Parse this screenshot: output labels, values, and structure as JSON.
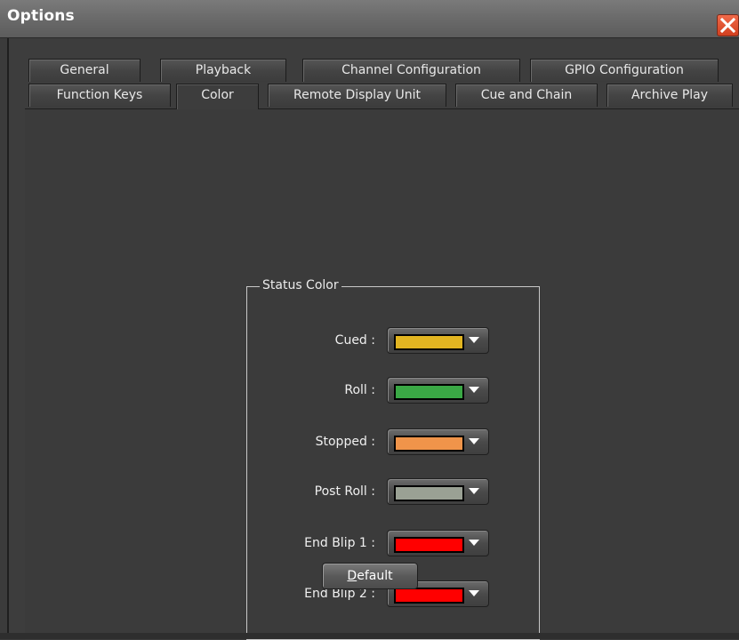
{
  "window": {
    "title": "Options"
  },
  "tabs": {
    "row1": [
      {
        "label": "General"
      },
      {
        "label": "Playback"
      },
      {
        "label": "Channel Configuration"
      },
      {
        "label": "GPIO Configuration"
      }
    ],
    "row2": [
      {
        "label": "Function Keys"
      },
      {
        "label": "Color",
        "active": true
      },
      {
        "label": "Remote Display Unit"
      },
      {
        "label": "Cue and Chain"
      },
      {
        "label": "Archive Play"
      }
    ]
  },
  "status_color": {
    "title": "Status Color",
    "rows": [
      {
        "label": "Cued :",
        "color": "#e2b521"
      },
      {
        "label": "Roll :",
        "color": "#3aa845"
      },
      {
        "label": "Stopped :",
        "color": "#f0944a"
      },
      {
        "label": "Post Roll :",
        "color": "#9aa194"
      },
      {
        "label": "End Blip 1 :",
        "color": "#ff0000"
      },
      {
        "label": "End Blip 2 :",
        "color": "#ff0000"
      }
    ]
  },
  "buttons": {
    "default_label_accel": "D",
    "default_label_rest": "efault"
  },
  "icons": {
    "close": "close-icon",
    "dropdown": "chevron-down-icon"
  }
}
